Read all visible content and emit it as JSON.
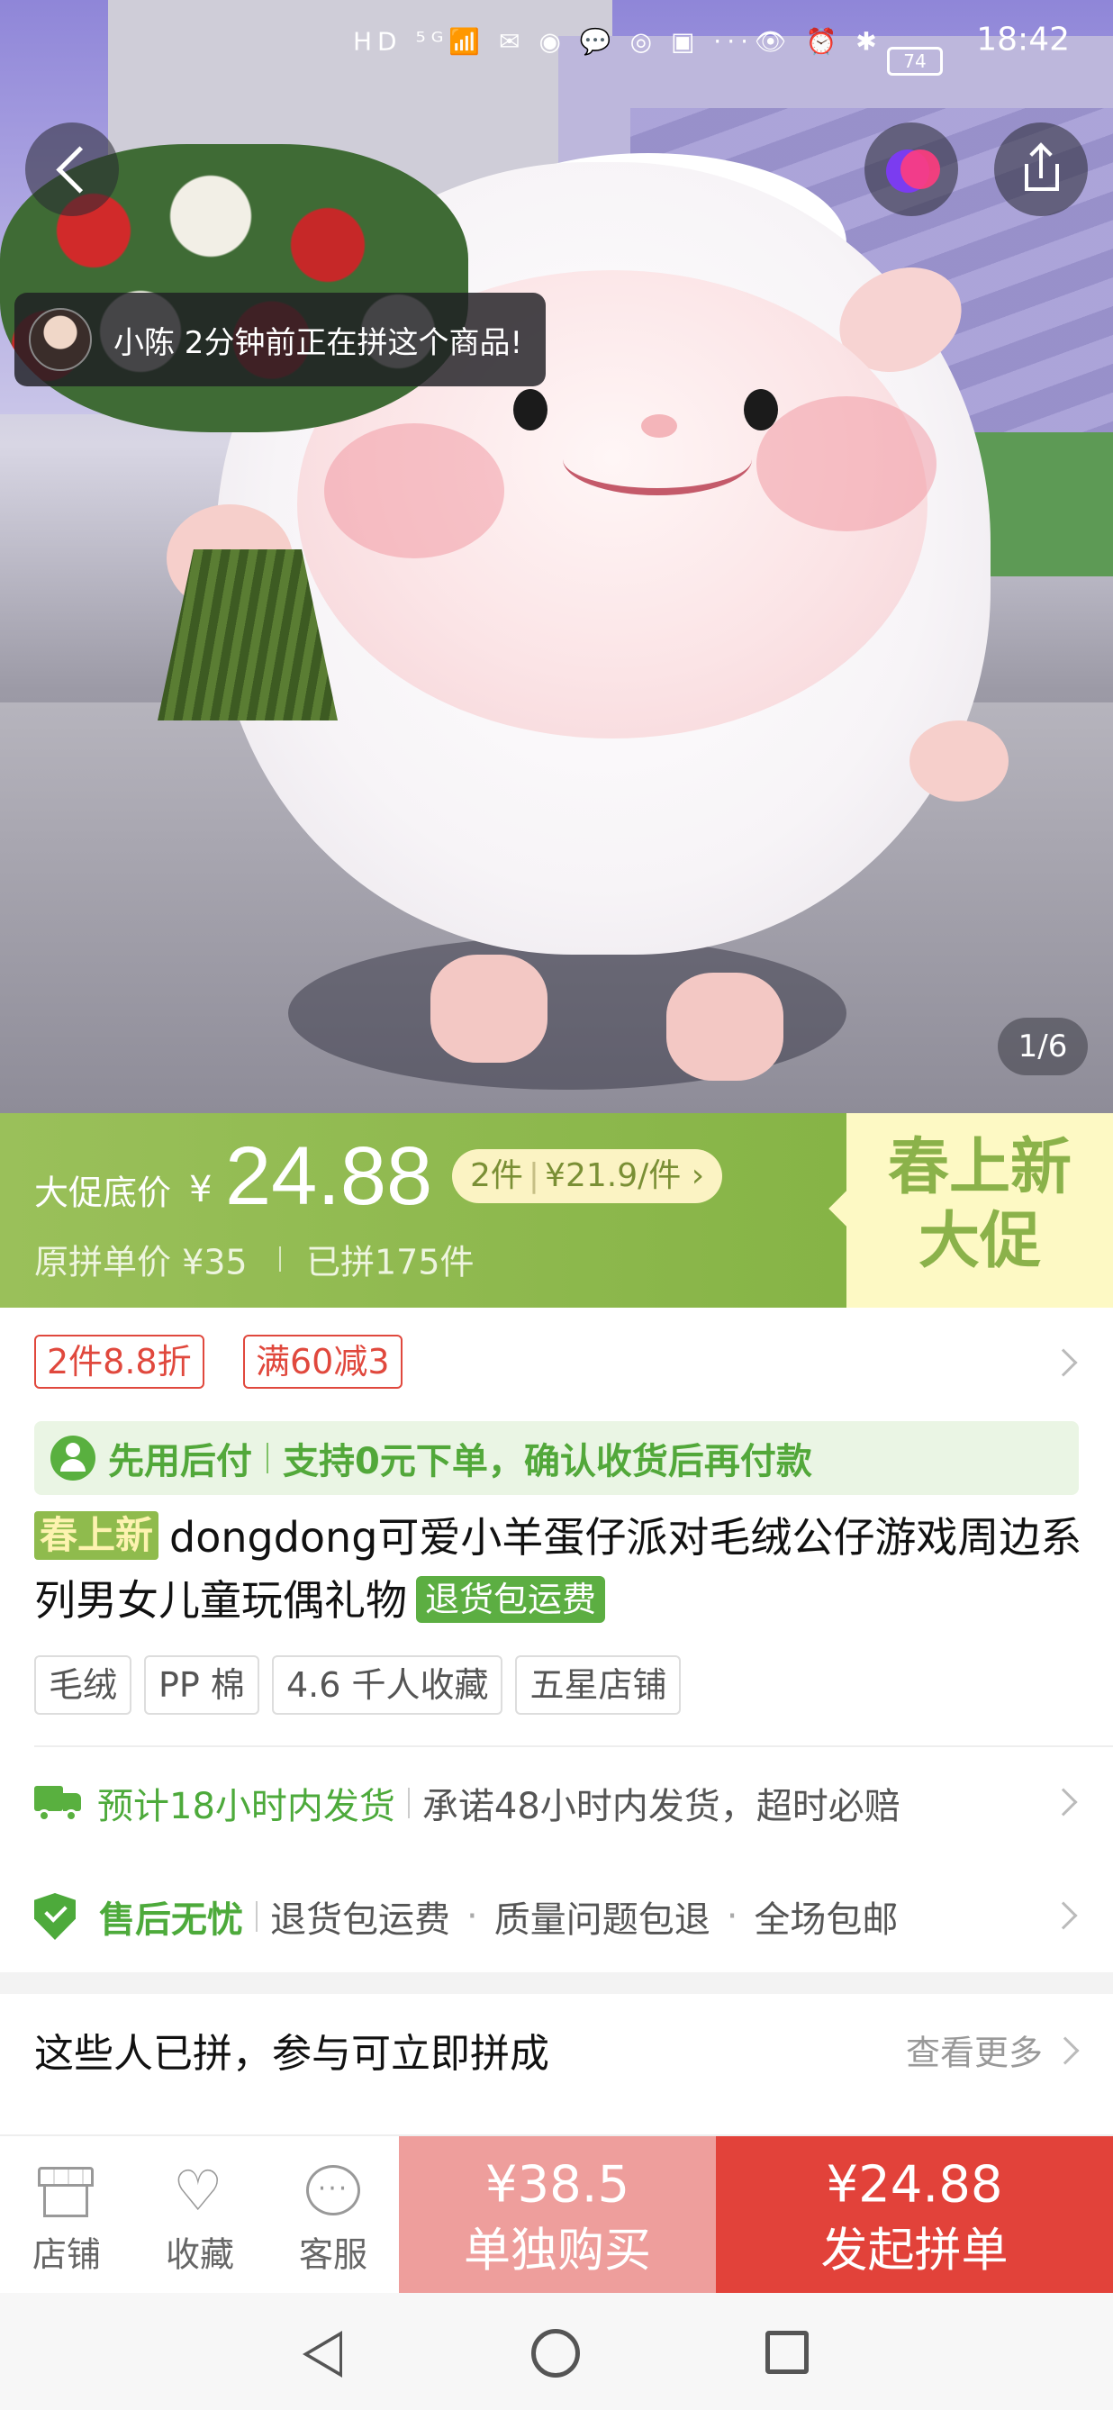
{
  "status_bar": {
    "icons_text": "HD ⁵ᴳ📶 ✉ ◉ 💬 ◎ ▣ ···",
    "right_icons": "👁 ⏰ ✱",
    "battery": "74",
    "time": "18:42"
  },
  "hero": {
    "buyer_toast": "小陈 2分钟前正在拼这个商品!",
    "page_indicator": "1/6"
  },
  "price_banner": {
    "promo_label": "大促底价",
    "currency": "¥",
    "price": "24.88",
    "multi_qty": "2件",
    "multi_price": "¥21.9/件",
    "multi_chevron": "›",
    "original_price": "原拼单价 ¥35",
    "sold": "已拼175件",
    "panel_line1": "春上新",
    "panel_line2": "大促"
  },
  "coupons": [
    "2件8.8折",
    "满60减3"
  ],
  "pay_later": {
    "title": "先用后付",
    "desc": "支持0元下单，确认收货后再付款"
  },
  "product": {
    "tag": "春上新",
    "title": "dongdong可爱小羊蛋仔派对毛绒公仔游戏周边系列男女儿童玩偶礼物",
    "badge": "退货包运费",
    "attributes": [
      "毛绒",
      "PP 棉",
      "4.6 千人收藏",
      "五星店铺"
    ]
  },
  "shipping": {
    "highlight": "预计18小时内发货",
    "detail": "承诺48小时内发货，超时必赔"
  },
  "after_sale": {
    "title": "售后无忧",
    "items": [
      "退货包运费",
      "质量问题包退",
      "全场包邮"
    ],
    "dot": "·"
  },
  "group_buy": {
    "title": "这些人已拼，参与可立即拼成",
    "see_more": "查看更多"
  },
  "action_bar": {
    "store": "店铺",
    "favorite": "收藏",
    "service": "客服",
    "single_price": "¥38.5",
    "single_label": "单独购买",
    "group_price": "¥24.88",
    "group_label": "发起拼单"
  },
  "colors": {
    "brand_green": "#8fbb4d",
    "service_green": "#4daa3b",
    "coupon_red": "#e0483d",
    "buy_group_red": "#e2423a",
    "buy_single_pink": "#ee9e9c"
  }
}
